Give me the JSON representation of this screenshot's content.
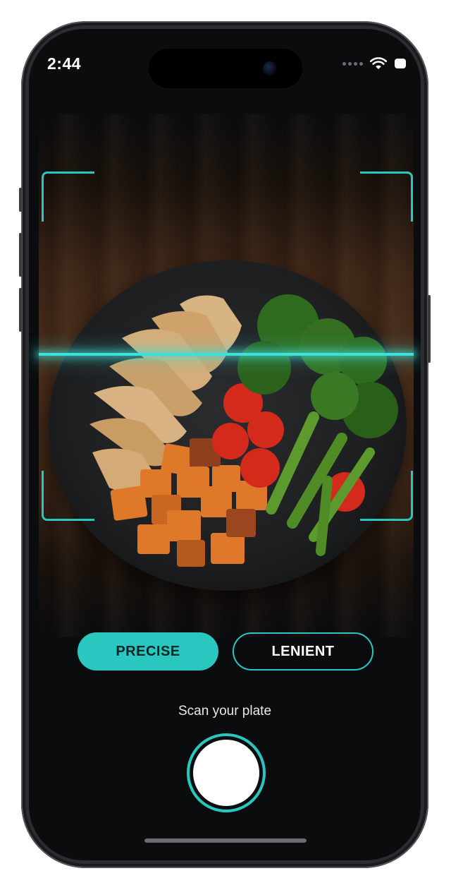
{
  "status_bar": {
    "time": "2:44",
    "icons": [
      "signal-dots-icon",
      "wifi-icon",
      "battery-icon"
    ]
  },
  "camera": {
    "subject": "plate-photo",
    "scan_frame_color": "#29c7c0"
  },
  "modes": {
    "precise_label": "PRECISE",
    "lenient_label": "LENIENT",
    "selected": "PRECISE"
  },
  "prompt": {
    "scan_label": "Scan your plate"
  },
  "colors": {
    "accent": "#29c7c0",
    "background": "#0b0c0e"
  },
  "icons": {
    "shutter": "shutter-button-icon"
  }
}
